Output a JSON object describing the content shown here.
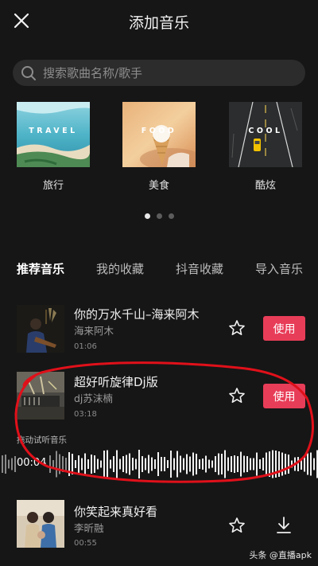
{
  "header": {
    "title": "添加音乐"
  },
  "search": {
    "placeholder": "搜索歌曲名称/歌手"
  },
  "categories": [
    {
      "label": "旅行",
      "thumb_text": "TRAVEL"
    },
    {
      "label": "美食",
      "thumb_text": "FOOD"
    },
    {
      "label": "酷炫",
      "thumb_text": "COOL"
    }
  ],
  "carousel": {
    "pages": 3,
    "active_page": 1
  },
  "tabs": [
    {
      "label": "推荐音乐",
      "active": true
    },
    {
      "label": "我的收藏",
      "active": false
    },
    {
      "label": "抖音收藏",
      "active": false
    },
    {
      "label": "导入音乐",
      "active": false
    }
  ],
  "songs": [
    {
      "title": "你的万水千山–海来阿木",
      "artist": "海来阿木",
      "duration": "01:06",
      "action": "使用"
    },
    {
      "title": "超好听旋律Dj版",
      "artist": "dj苏沫楠",
      "duration": "03:18",
      "action": "使用"
    },
    {
      "title": "你笑起来真好看",
      "artist": "李昕融",
      "duration": "00:55",
      "action": "download"
    }
  ],
  "preview": {
    "hint": "拖动试听音乐",
    "time": "00:04"
  },
  "watermark": "头条 @直播apk",
  "colors": {
    "background": "#161616",
    "accent": "#e83d58",
    "annotation": "#e0101a"
  }
}
